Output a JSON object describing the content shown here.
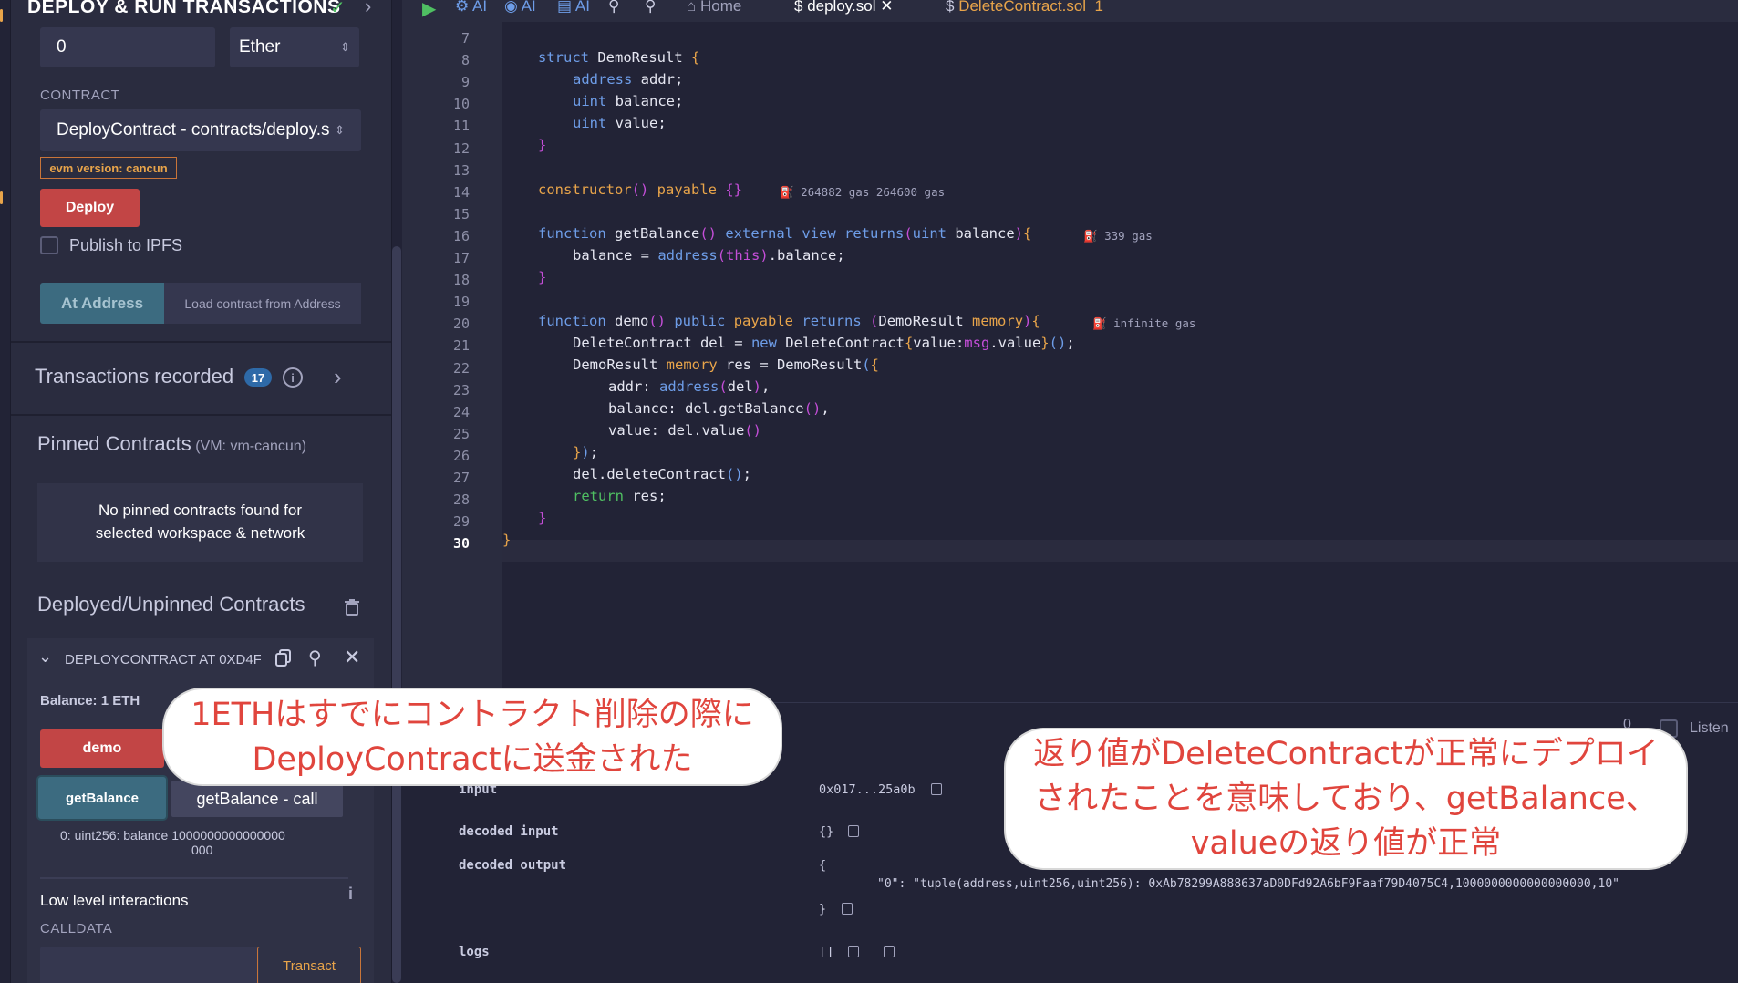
{
  "panel": {
    "title": "DEPLOY & RUN TRANSACTIONS",
    "value_input": "0",
    "unit_select": "Ether",
    "contract_label": "CONTRACT",
    "contract_select": "DeployContract - contracts/deploy.s",
    "evm_tag": "evm version: cancun",
    "deploy_button": "Deploy",
    "publish_label": "Publish to IPFS",
    "at_address_button": "At Address",
    "load_contract_placeholder": "Load contract from Address",
    "transactions_label": "Transactions recorded",
    "transactions_count": "17",
    "pinned_title": "Pinned Contracts",
    "pinned_env": "(VM: vm-cancun)",
    "no_pinned_line1": "No pinned contracts found for",
    "no_pinned_line2": "selected workspace & network",
    "deployed_title": "Deployed/Unpinned Contracts",
    "instance_title": "DEPLOYCONTRACT AT 0XD4F",
    "balance": "Balance: 1 ETH",
    "demo_button": "demo",
    "getbalance_button": "getBalance",
    "tooltip": "getBalance - call",
    "result_line1": "0:  uint256: balance 1000000000000000",
    "result_line2": "000",
    "low_level": "Low level interactions",
    "calldata_label": "CALLDATA",
    "transact_button": "Transact"
  },
  "tabs": {
    "home": "Home",
    "deploy": "deploy.sol",
    "delete": "DeleteContract.sol",
    "delete_errors": "1",
    "ai_label": "AI"
  },
  "editor": {
    "line_numbers": [
      "7",
      "8",
      "9",
      "10",
      "11",
      "12",
      "13",
      "14",
      "15",
      "16",
      "17",
      "18",
      "19",
      "20",
      "21",
      "22",
      "23",
      "24",
      "25",
      "26",
      "27",
      "28",
      "29",
      "30"
    ],
    "gas": {
      "constructor": "264882 gas 264600 gas",
      "getbalance": "339 gas",
      "demo": "infinite gas"
    }
  },
  "terminal": {
    "input_key": "input",
    "input_val": "0x017...25a0b",
    "decoded_input_key": "decoded input",
    "decoded_input_val": "{}",
    "decoded_output_key": "decoded output",
    "decoded_output_open": "{",
    "decoded_output_val": "\"0\": \"tuple(address,uint256,uint256): 0xAb78299A888637aD0DFd92A6bF9Faaf79D4075C4,1000000000000000000,10\"",
    "decoded_output_close": "}",
    "logs_key": "logs",
    "logs_val": "[]",
    "listen_label": "Listen",
    "counter": "0"
  },
  "callouts": {
    "left_line1": "1ETHはすでにコントラクト削除の際に",
    "left_line2": "DeployContractに送金された",
    "right_line1": "返り値がDeleteContractが正常にデプロイ",
    "right_line2": "されたことを意味しており、getBalance、",
    "right_line3": "valueの返り値が正常"
  },
  "colors": {
    "accent_red": "#c24545",
    "callout_text": "#e0453d",
    "badge_blue": "#2e6aa8",
    "tag_orange": "#e8a44a"
  }
}
